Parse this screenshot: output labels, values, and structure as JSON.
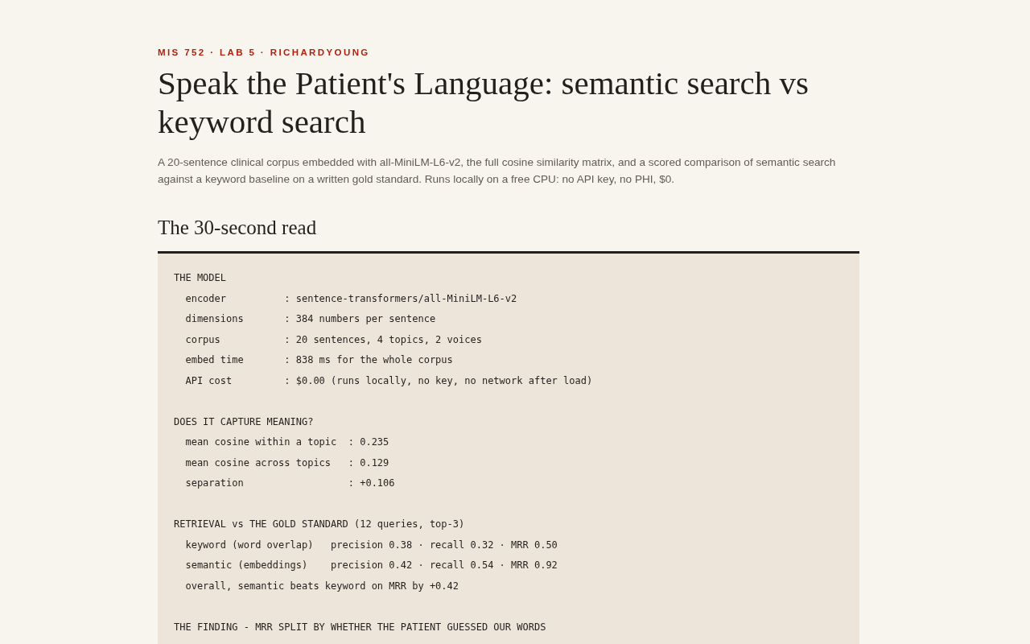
{
  "eyebrow": "MIS 752 · LAB 5 · RICHARDYOUNG",
  "title": "Speak the Patient's Language: semantic search vs keyword search",
  "description": "A 20-sentence clinical corpus embedded with all-MiniLM-L6-v2, the full cosine similarity matrix, and a scored comparison of semantic search against a keyword baseline on a written gold standard. Runs locally on a free CPU: no API key, no PHI, $0.",
  "section_heading": "The 30-second read",
  "readout": [
    {
      "heading": "THE MODEL",
      "lines": [
        "  encoder          : sentence-transformers/all-MiniLM-L6-v2",
        "  dimensions       : 384 numbers per sentence",
        "  corpus           : 20 sentences, 4 topics, 2 voices",
        "  embed time       : 838 ms for the whole corpus",
        "  API cost         : $0.00 (runs locally, no key, no network after load)"
      ]
    },
    {
      "heading": "DOES IT CAPTURE MEANING?",
      "lines": [
        "  mean cosine within a topic  : 0.235",
        "  mean cosine across topics   : 0.129",
        "  separation                  : +0.106"
      ]
    },
    {
      "heading": "RETRIEVAL vs THE GOLD STANDARD (12 queries, top-3)",
      "lines": [
        "  keyword (word overlap)   precision 0.38 · recall 0.32 · MRR 0.50",
        "  semantic (embeddings)    precision 0.42 · recall 0.54 · MRR 0.92",
        "  overall, semantic beats keyword on MRR by +0.42"
      ]
    },
    {
      "heading": "THE FINDING - MRR SPLIT BY WHETHER THE PATIENT GUESSED OUR WORDS"
    }
  ]
}
